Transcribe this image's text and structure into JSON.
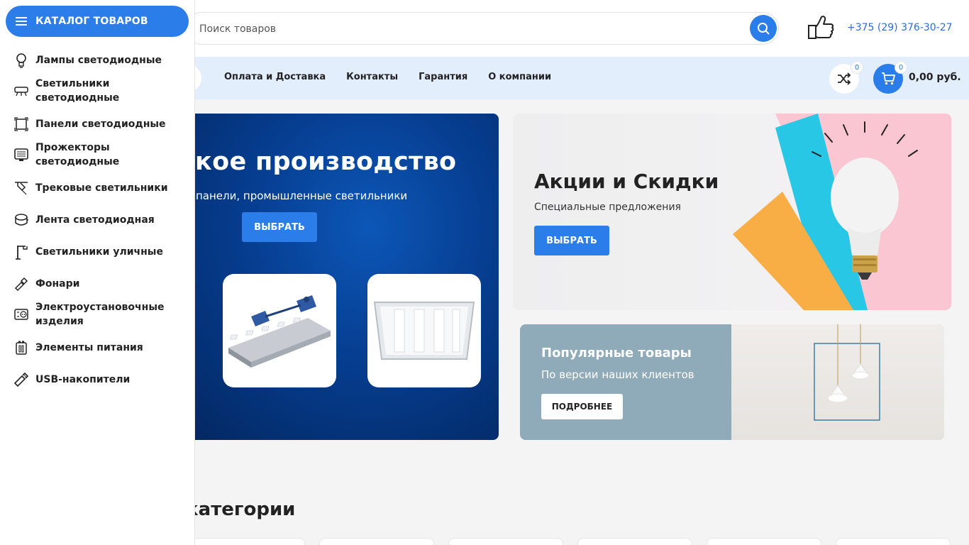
{
  "header": {
    "search_placeholder": "Поиск товаров",
    "phone": "+375 (29) 376-30-27"
  },
  "nav": {
    "links": [
      "Оплата и Доставка",
      "Контакты",
      "Гарантия",
      "О компании"
    ],
    "compare_count": "0",
    "cart_count": "0",
    "cart_total": "0,00 руб."
  },
  "sidebar": {
    "catalog_label": "КАТАЛОГ ТОВАРОВ",
    "items": [
      {
        "label": "Лампы светодиодные",
        "icon": "bulb-icon"
      },
      {
        "label": "Светильники светодиодные",
        "icon": "ceiling-lamp-icon"
      },
      {
        "label": "Панели светодиодные",
        "icon": "panel-icon"
      },
      {
        "label": "Прожекторы светодиодные",
        "icon": "floodlight-icon"
      },
      {
        "label": "Трековые светильники",
        "icon": "track-light-icon"
      },
      {
        "label": "Лента светодиодная",
        "icon": "led-strip-icon"
      },
      {
        "label": "Светильники уличные",
        "icon": "street-light-icon"
      },
      {
        "label": "Фонари",
        "icon": "flashlight-icon"
      },
      {
        "label": "Электроустановочные изделия",
        "icon": "socket-icon"
      },
      {
        "label": "Элементы питания",
        "icon": "battery-icon"
      },
      {
        "label": "USB-накопители",
        "icon": "usb-icon"
      }
    ]
  },
  "hero": {
    "title": "ское производство",
    "subtitle": "панели, промышленные светильники",
    "button": "ВЫБРАТЬ"
  },
  "promo": {
    "title": "Акции и Скидки",
    "subtitle": "Специальные предложения",
    "button": "ВЫБРАТЬ"
  },
  "popular": {
    "title": "Популярные товары",
    "subtitle": "По версии наших клиентов",
    "button": "ПОДРОБНЕЕ"
  },
  "categories": {
    "title": "категории"
  },
  "colors": {
    "accent": "#2b7de9",
    "nav_bg": "#e3eefc",
    "hero_bg": "#063d8f",
    "popular_bg": "#8fabb9"
  }
}
